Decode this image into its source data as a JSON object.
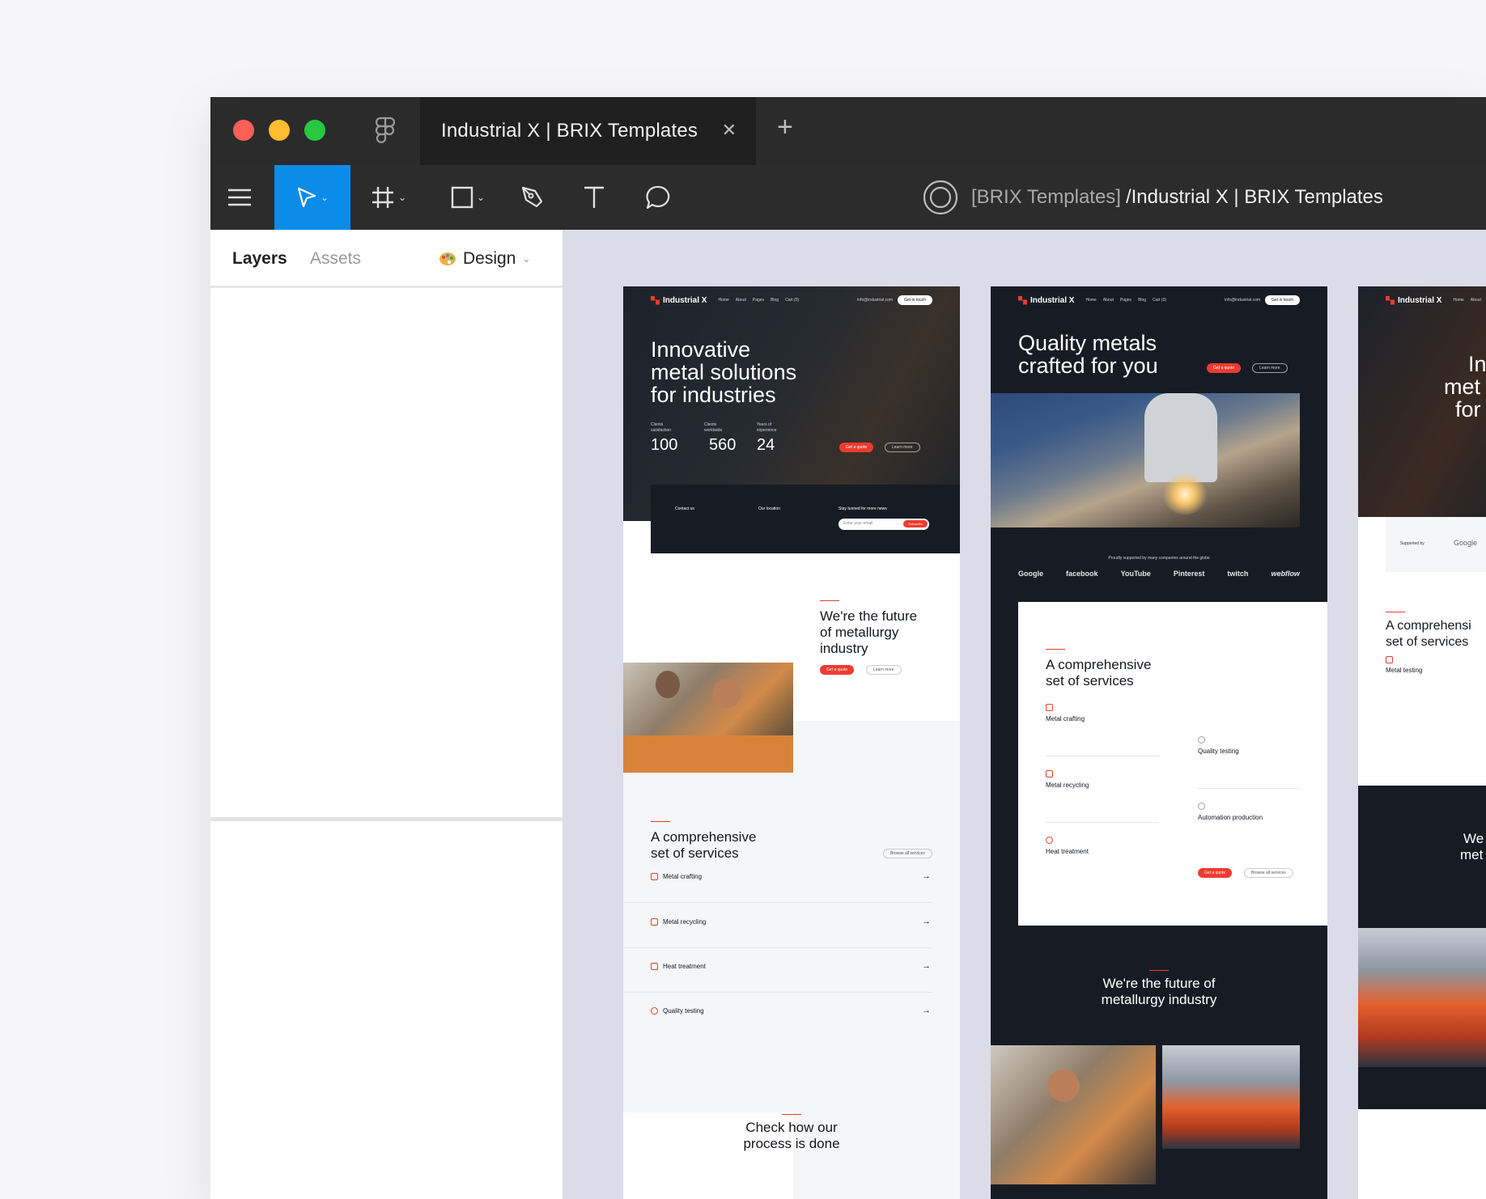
{
  "window": {
    "tab_title": "Industrial X | BRIX Templates",
    "tab_close": "✕",
    "tab_add": "+"
  },
  "breadcrumb": {
    "team": "[BRIX Templates]",
    "file": "/Industrial X | BRIX Templates"
  },
  "panel": {
    "tabs": [
      "Layers",
      "Assets",
      "Design"
    ]
  },
  "site": {
    "logo": "Industrial X",
    "nav_links": [
      "Home",
      "About",
      "Pages",
      "Blog",
      "Cart (0)"
    ],
    "nav_email": "info@industrial.com",
    "nav_cta": "Get in touch",
    "btn_quote": "Get a quote",
    "btn_learn": "Learn more",
    "btn_browse": "Browse all services",
    "learn_more_link": "Learn more →"
  },
  "frame1": {
    "hero_title": "Innovative\nmetal solutions\nfor industries",
    "stats": [
      {
        "label": "Clients\nsatisfaction",
        "value": "100",
        "suffix": "%"
      },
      {
        "label": "Clients\nworldwide",
        "value": "560",
        "suffix": "+"
      },
      {
        "label": "Years of\nexperience",
        "value": "24",
        "suffix": "+"
      }
    ],
    "contact_label": "Contact us",
    "location_label": "Our location",
    "newsletter_label": "Stay tunned for more news",
    "email_placeholder": "Enter your email",
    "subscribe": "Subscribe",
    "future_title": "We're the future\nof metallurgy\nindustry",
    "services_title": "A comprehensive\nset of services",
    "services": [
      "Metal crafting",
      "Metal recycling",
      "Heat treatment",
      "Quality testing"
    ],
    "process_title": "Check how our\nprocess is done"
  },
  "frame2": {
    "hero_title": "Quality metals\ncrafted for you",
    "supported": "Proudly supported by many companies around the globe",
    "logos": [
      "Google",
      "facebook",
      "YouTube",
      "Pinterest",
      "twitch",
      "webflow"
    ],
    "services_title": "A comprehensive\nset of services",
    "services_left": [
      "Metal crafting",
      "Metal recycling",
      "Heat treatment"
    ],
    "services_right": [
      "Quality testing",
      "Automation production"
    ],
    "future_title": "We're the future of\nmetallurgy industry"
  },
  "frame3": {
    "hero_partial": [
      "In",
      "met",
      "for"
    ],
    "supported_by": "Supported by",
    "google": "Google",
    "services_title": "A comprehensi\nset of services",
    "service": "Metal testing",
    "future_partial": [
      "We",
      "met"
    ]
  },
  "colors": {
    "accent": "#ee3b30",
    "figma_blue": "#0c8ce9",
    "dark_bg": "#171c24",
    "toolbar": "#2c2c2c"
  }
}
